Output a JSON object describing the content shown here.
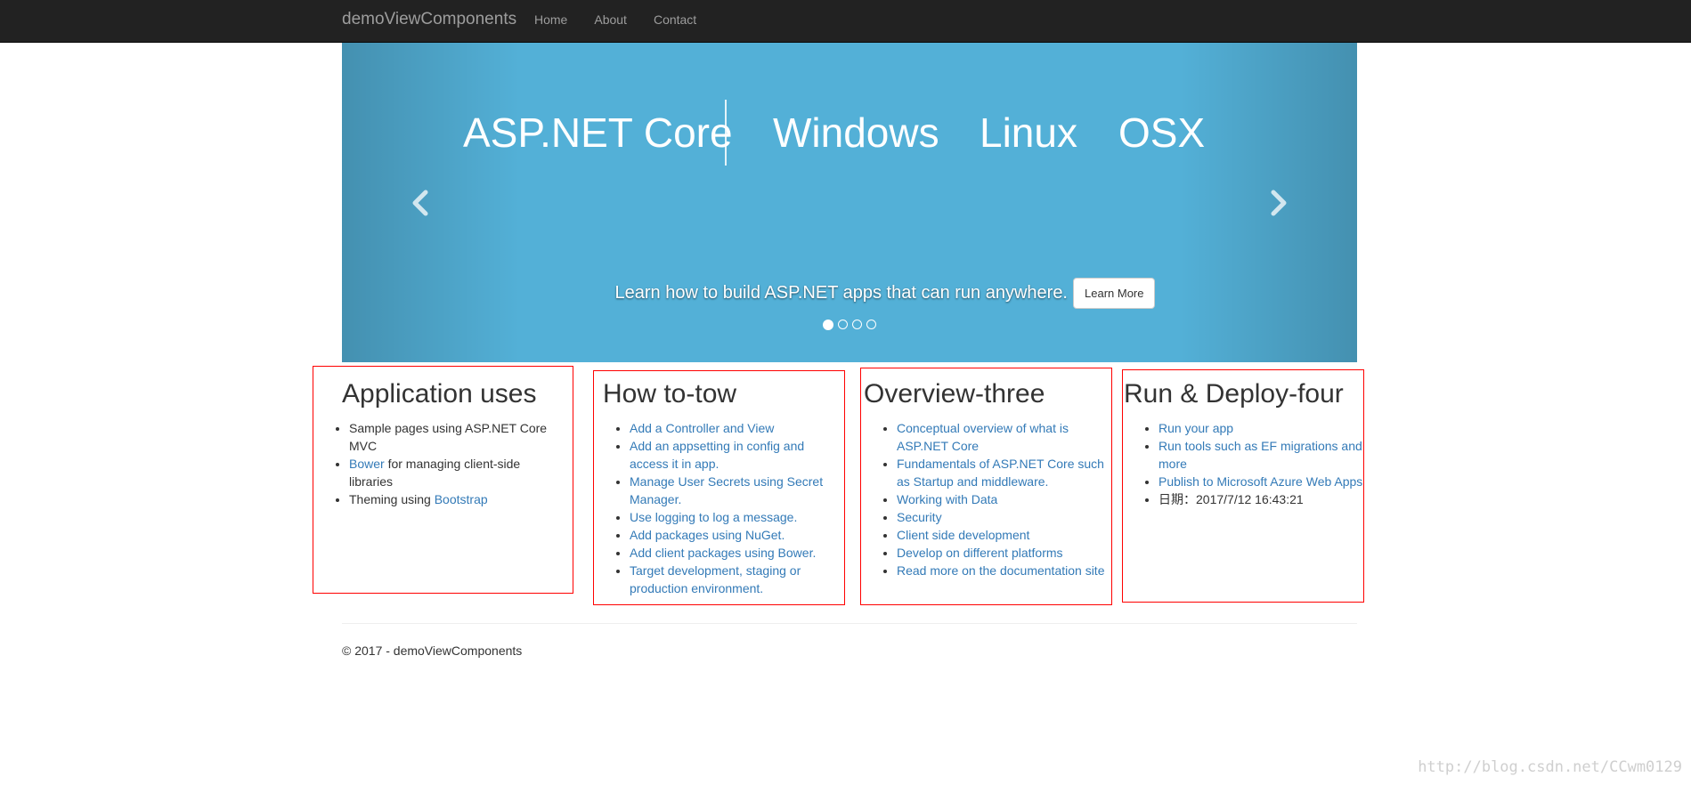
{
  "navbar": {
    "brand": "demoViewComponents",
    "links": [
      {
        "label": "Home"
      },
      {
        "label": "About"
      },
      {
        "label": "Contact"
      }
    ]
  },
  "carousel": {
    "banner": {
      "core": "ASP.NET Core",
      "os": [
        "Windows",
        "Linux",
        "OSX"
      ]
    },
    "caption": "Learn how to build ASP.NET apps that can run anywhere.",
    "button_label": "Learn More",
    "slide_count": 4,
    "active_slide": 1
  },
  "columns": [
    {
      "title": "Application uses",
      "items": [
        {
          "parts": [
            {
              "text": "Sample pages using ASP.NET Core MVC",
              "link": false
            }
          ]
        },
        {
          "parts": [
            {
              "text": "Bower",
              "link": true
            },
            {
              "text": " for managing client-side libraries",
              "link": false
            }
          ]
        },
        {
          "parts": [
            {
              "text": "Theming using ",
              "link": false
            },
            {
              "text": "Bootstrap",
              "link": true
            }
          ]
        }
      ]
    },
    {
      "title": "How to-tow",
      "items": [
        {
          "parts": [
            {
              "text": "Add a Controller and View",
              "link": true
            }
          ]
        },
        {
          "parts": [
            {
              "text": "Add an appsetting in config and access it in app.",
              "link": true
            }
          ]
        },
        {
          "parts": [
            {
              "text": "Manage User Secrets using Secret Manager.",
              "link": true
            }
          ]
        },
        {
          "parts": [
            {
              "text": "Use logging to log a message.",
              "link": true
            }
          ]
        },
        {
          "parts": [
            {
              "text": "Add packages using NuGet.",
              "link": true
            }
          ]
        },
        {
          "parts": [
            {
              "text": "Add client packages using Bower.",
              "link": true
            }
          ]
        },
        {
          "parts": [
            {
              "text": "Target development, staging or production environment.",
              "link": true
            }
          ]
        }
      ]
    },
    {
      "title": "Overview-three",
      "items": [
        {
          "parts": [
            {
              "text": "Conceptual overview of what is ASP.NET Core",
              "link": true
            }
          ]
        },
        {
          "parts": [
            {
              "text": "Fundamentals of ASP.NET Core such as Startup and middleware.",
              "link": true
            }
          ]
        },
        {
          "parts": [
            {
              "text": "Working with Data",
              "link": true
            }
          ]
        },
        {
          "parts": [
            {
              "text": "Security",
              "link": true
            }
          ]
        },
        {
          "parts": [
            {
              "text": "Client side development",
              "link": true
            }
          ]
        },
        {
          "parts": [
            {
              "text": "Develop on different platforms",
              "link": true
            }
          ]
        },
        {
          "parts": [
            {
              "text": "Read more on the documentation site",
              "link": true
            }
          ]
        }
      ]
    },
    {
      "title": "Run & Deploy-four",
      "items": [
        {
          "parts": [
            {
              "text": "Run your app",
              "link": true
            }
          ]
        },
        {
          "parts": [
            {
              "text": "Run tools such as EF migrations and more",
              "link": true
            }
          ]
        },
        {
          "parts": [
            {
              "text": "Publish to Microsoft Azure Web Apps",
              "link": true
            }
          ]
        },
        {
          "parts": [
            {
              "text": "日期：2017/7/12 16:43:21",
              "link": false
            }
          ]
        }
      ]
    }
  ],
  "footer": {
    "text": "© 2017 - demoViewComponents"
  },
  "watermark": "http://blog.csdn.net/CCwm0129",
  "colors": {
    "navbar_bg": "#222222",
    "navbar_text": "#9d9d9d",
    "carousel_bg": "#53b0d7",
    "link": "#337ab7",
    "highlight_border": "#ff0000"
  },
  "icons": {
    "prev": "chevron-left-icon",
    "next": "chevron-right-icon"
  }
}
